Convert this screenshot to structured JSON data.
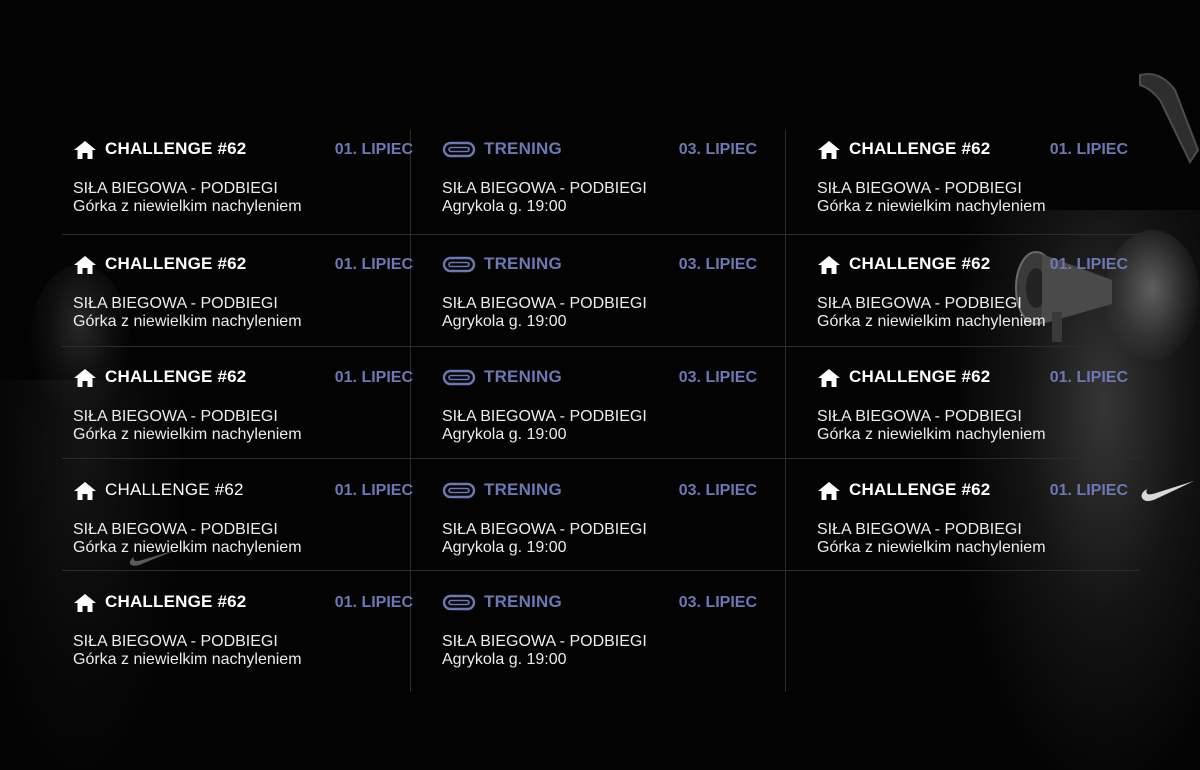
{
  "accent_color": "#6d78b2",
  "columns": [
    {
      "items": [
        {
          "icon": "home-icon",
          "title": "CHALLENGE #62",
          "date": "01. LIPIEC",
          "line1": "SIŁA BIEGOWA - PODBIEGI",
          "line2": "Górka z niewielkim nachyleniem"
        },
        {
          "icon": "home-icon",
          "title": "CHALLENGE #62",
          "date": "01. LIPIEC",
          "line1": "SIŁA BIEGOWA - PODBIEGI",
          "line2": "Górka z niewielkim nachyleniem"
        },
        {
          "icon": "home-icon",
          "title": "CHALLENGE #62",
          "date": "01. LIPIEC",
          "line1": "SIŁA BIEGOWA - PODBIEGI",
          "line2": "Górka z niewielkim nachyleniem"
        },
        {
          "icon": "home-icon",
          "title": "CHALLENGE #62",
          "date": "01. LIPIEC",
          "line1": "SIŁA BIEGOWA - PODBIEGI",
          "line2": "Górka z niewielkim nachyleniem"
        },
        {
          "icon": "home-icon",
          "title": "CHALLENGE #62",
          "date": "01. LIPIEC",
          "line1": "SIŁA BIEGOWA - PODBIEGI",
          "line2": "Górka z niewielkim nachyleniem"
        }
      ]
    },
    {
      "items": [
        {
          "icon": "running-track-icon",
          "title": "TRENING",
          "date": "03. LIPIEC",
          "line1": "SIŁA BIEGOWA - PODBIEGI",
          "line2": "Agrykola g. 19:00"
        },
        {
          "icon": "running-track-icon",
          "title": "TRENING",
          "date": "03. LIPIEC",
          "line1": "SIŁA BIEGOWA - PODBIEGI",
          "line2": "Agrykola g. 19:00"
        },
        {
          "icon": "running-track-icon",
          "title": "TRENING",
          "date": "03. LIPIEC",
          "line1": "SIŁA BIEGOWA - PODBIEGI",
          "line2": "Agrykola g. 19:00"
        },
        {
          "icon": "running-track-icon",
          "title": "TRENING",
          "date": "03. LIPIEC",
          "line1": "SIŁA BIEGOWA - PODBIEGI",
          "line2": "Agrykola g. 19:00"
        },
        {
          "icon": "running-track-icon",
          "title": "TRENING",
          "date": "03. LIPIEC",
          "line1": "SIŁA BIEGOWA - PODBIEGI",
          "line2": "Agrykola g. 19:00"
        }
      ]
    },
    {
      "items": [
        {
          "icon": "home-icon",
          "title": "CHALLENGE #62",
          "date": "01. LIPIEC",
          "line1": "SIŁA BIEGOWA - PODBIEGI",
          "line2": "Górka z niewielkim nachyleniem"
        },
        {
          "icon": "home-icon",
          "title": "CHALLENGE #62",
          "date": "01. LIPIEC",
          "line1": "SIŁA BIEGOWA - PODBIEGI",
          "line2": "Górka z niewielkim nachyleniem"
        },
        {
          "icon": "home-icon",
          "title": "CHALLENGE #62",
          "date": "01. LIPIEC",
          "line1": "SIŁA BIEGOWA - PODBIEGI",
          "line2": "Górka z niewielkim nachyleniem"
        },
        {
          "icon": "home-icon",
          "title": "CHALLENGE #62",
          "date": "01. LIPIEC",
          "line1": "SIŁA BIEGOWA - PODBIEGI",
          "line2": "Górka z niewielkim nachyleniem"
        }
      ]
    }
  ]
}
